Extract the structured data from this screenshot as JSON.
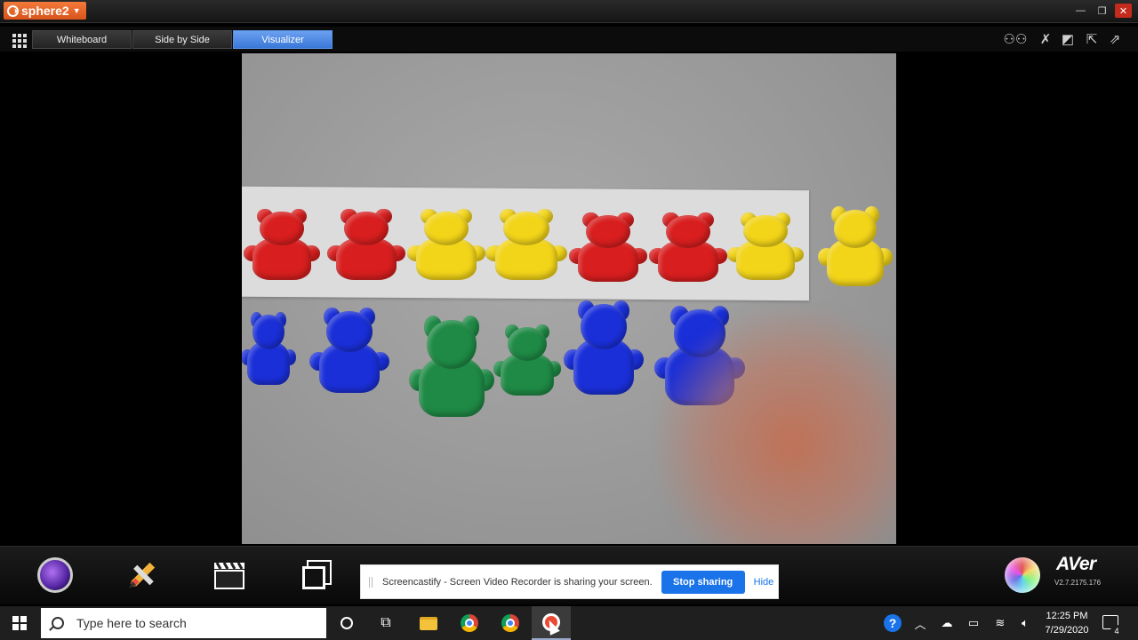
{
  "titlebar": {
    "app_name": "sphere2"
  },
  "tabs": [
    {
      "label": "Whiteboard",
      "active": false
    },
    {
      "label": "Side by Side",
      "active": false
    },
    {
      "label": "Visualizer",
      "active": true
    }
  ],
  "toolbar_icons": [
    "participants-icon",
    "clear-icon",
    "fullscreen-icon",
    "export-icon",
    "popout-icon"
  ],
  "bottom_toolbar": {
    "icons": [
      "camera-icon",
      "pencil-icon",
      "clapper-icon",
      "snapshot-icon",
      "color-wheel-icon"
    ],
    "brand": "AVer",
    "version": "V2.7.2175.176"
  },
  "feed": {
    "strip_bears": [
      "red",
      "red",
      "yellow",
      "yellow",
      "red",
      "red",
      "yellow"
    ],
    "loose_bears": [
      "yellow",
      "blue",
      "blue",
      "green",
      "green",
      "blue",
      "blue"
    ]
  },
  "banner": {
    "message": "Screencastify - Screen Video Recorder is sharing your screen.",
    "stop_label": "Stop sharing",
    "hide_label": "Hide"
  },
  "taskbar": {
    "search_placeholder": "Type here to search",
    "time": "12:25 PM",
    "date": "7/29/2020",
    "notification_count": "4"
  },
  "colors": {
    "accent": "#1a73e8",
    "tab_active": "#3a78d8",
    "red_bear": "#d81e1e",
    "yellow_bear": "#f2d419",
    "blue_bear": "#1a2fd8",
    "green_bear": "#1e8a45"
  }
}
